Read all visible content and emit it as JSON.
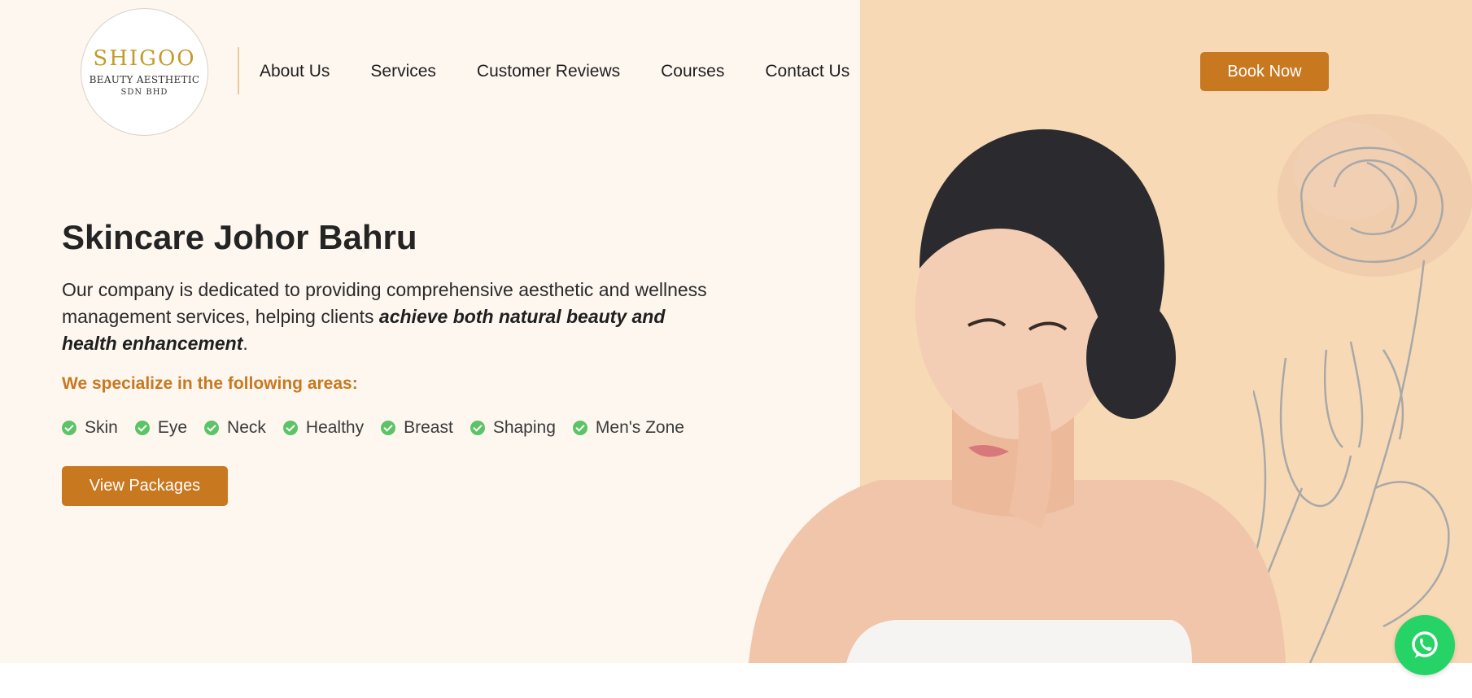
{
  "logo": {
    "name": "SHIGOO",
    "subtitle": "BEAUTY AESTHETIC",
    "company": "SDN BHD"
  },
  "nav": {
    "items": [
      "About Us",
      "Services",
      "Customer Reviews",
      "Courses",
      "Contact Us"
    ]
  },
  "header": {
    "book_label": "Book Now"
  },
  "hero": {
    "title": "Skincare Johor Bahru",
    "desc_prefix": "Our company is dedicated to providing comprehensive aesthetic and wellness management services, helping clients ",
    "desc_emphasis": "achieve both natural beauty and health enhancement",
    "desc_suffix": ".",
    "specialize_heading": "We specialize in the following areas:",
    "areas": [
      "Skin",
      "Eye",
      "Neck",
      "Healthy",
      "Breast",
      "Shaping",
      "Men's Zone"
    ],
    "cta_label": "View Packages"
  },
  "icons": {
    "check": "check-circle-icon",
    "whatsapp": "whatsapp-icon"
  },
  "colors": {
    "accent": "#c8781f",
    "hero_bg": "#fef7f0",
    "hero_right_bg": "#f7d9b5",
    "check": "#5cc466",
    "whatsapp": "#25d366",
    "logo_gold": "#c49a2a"
  }
}
